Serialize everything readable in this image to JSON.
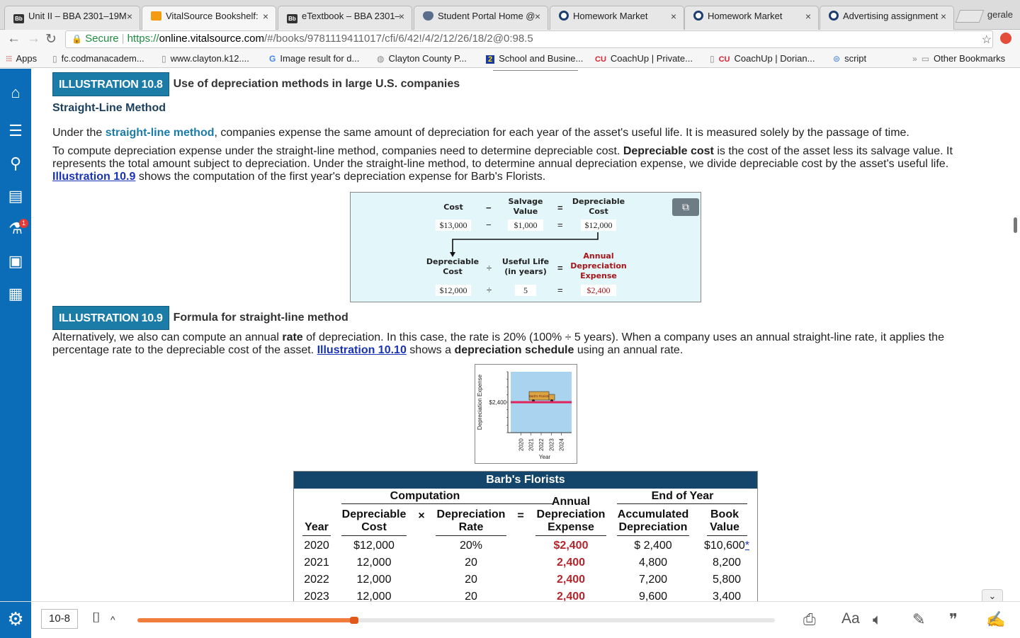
{
  "browser": {
    "tabs": [
      {
        "label": "Unit II – BBA 2301–19M",
        "icon": "bb"
      },
      {
        "label": "VitalSource Bookshelf: ",
        "icon": "vs"
      },
      {
        "label": "eTextbook – BBA 2301–",
        "icon": "bb"
      },
      {
        "label": "Student Portal Home @ ",
        "icon": "shield"
      },
      {
        "label": "Homework Market",
        "icon": "hex"
      },
      {
        "label": "Homework Market",
        "icon": "hex"
      },
      {
        "label": "Advertising assignment",
        "icon": "hex"
      }
    ],
    "profile": "gerale",
    "address": {
      "secure_label": "Secure",
      "protocol": "https://",
      "host": "online.vitalsource.com",
      "path": "/#/books/9781119411017/cfi/6/42!/4/2/12/26/18/2@0:98.5"
    },
    "bookmarks": [
      {
        "label": "Apps",
        "icon": "apps"
      },
      {
        "label": "fc.codmanacadem...",
        "icon": "page"
      },
      {
        "label": "www.clayton.k12....",
        "icon": "page"
      },
      {
        "label": "Image result for d...",
        "icon": "google"
      },
      {
        "label": "Clayton County P...",
        "icon": "globe"
      },
      {
        "label": "School and Busine...",
        "icon": "two"
      },
      {
        "label": "CoachUp | Private...",
        "icon": "cu"
      },
      {
        "label": "CoachUp | Dorian...",
        "icon": "cu"
      },
      {
        "label": "script",
        "icon": "script"
      },
      {
        "label": "Other Bookmarks",
        "icon": "folder"
      }
    ]
  },
  "content": {
    "ill108": {
      "tag": "ILLUSTRATION 10.8",
      "title": "Use of depreciation methods in large U.S. companies"
    },
    "section_heading": "Straight-Line Method",
    "para1": {
      "before": "Under the ",
      "term": "straight-line method",
      "after": ", companies expense the same amount of depreciation for each year of the asset's useful life. It is measured solely by the passage of time."
    },
    "para2": {
      "t1": "To compute depreciation expense under the straight-line method, companies need to determine depreciable cost. ",
      "bold1": "Depreciable cost",
      "t2": " is the cost of the asset less its salvage value. It represents the total amount subject to depreciation. Under the straight-line method, to determine annual depreciation expense, we divide depreciable cost by the asset's useful life. ",
      "link": "Illustration 10.9",
      "t3": " shows the computation of the first year's depreciation expense for Barb's Florists."
    },
    "formula": {
      "row1_labels": {
        "cost": "Cost",
        "minus": "−",
        "salvage": "Salvage\nValue",
        "equals": "=",
        "depreciable": "Depreciable\nCost"
      },
      "row1_values": {
        "cost": "$13,000",
        "minus": "−",
        "salvage": "$1,000",
        "equals": "=",
        "depreciable": "$12,000"
      },
      "row2_labels": {
        "depreciable": "Depreciable\nCost",
        "divide": "÷",
        "useful_life": "Useful Life\n(in years)",
        "equals": "=",
        "annual": "Annual\nDepreciation\nExpense"
      },
      "row2_values": {
        "depreciable": "$12,000",
        "divide": "÷",
        "useful_life": "5",
        "equals": "=",
        "annual": "$2,400"
      }
    },
    "ill109": {
      "tag": "ILLUSTRATION 10.9",
      "title": "Formula for straight-line method"
    },
    "para3": {
      "t1": "Alternatively, we also can compute an annual ",
      "bold1": "rate",
      "t2": " of depreciation. In this case, the rate is 20% (100% ÷ 5 years). When a company uses an annual straight-line rate, it applies the percentage rate to the depreciable cost of the asset. ",
      "link": "Illustration 10.10",
      "t3": " shows a ",
      "bold2": "depreciation schedule",
      "t4": " using an annual rate."
    },
    "chart_data": {
      "type": "line",
      "ylabel": "Depreciation Expense",
      "xlabel": "Year",
      "x": [
        "2020",
        "2021",
        "2022",
        "2023",
        "2024"
      ],
      "series": [
        {
          "values": [
            2400,
            2400,
            2400,
            2400,
            2400
          ]
        }
      ],
      "value_label": "$2,400",
      "truck_label": "Barb's Florists",
      "colors": {
        "plot_bg": "#a9d3ef",
        "line": "#e2245a"
      }
    },
    "table": {
      "title": "Barb's Florists",
      "group_computation": "Computation",
      "group_end": "End of Year",
      "headers": {
        "year": "Year",
        "dep_cost": "Depreciable\nCost",
        "times": "×",
        "dep_rate": "Depreciation\nRate",
        "equals": "=",
        "annual": "Annual\nDepreciation\nExpense",
        "accum": "Accumulated\nDepreciation",
        "book": "Book\nValue"
      },
      "rows": [
        {
          "year": "2020",
          "cost": "$12,000",
          "rate": "20%",
          "expense": "$2,400",
          "accum": "$ 2,400",
          "book": "$10,600",
          "mark": "*"
        },
        {
          "year": "2021",
          "cost": "12,000",
          "rate": "20",
          "expense": "2,400",
          "accum": "4,800",
          "book": "8,200",
          "mark": ""
        },
        {
          "year": "2022",
          "cost": "12,000",
          "rate": "20",
          "expense": "2,400",
          "accum": "7,200",
          "book": "5,800",
          "mark": ""
        },
        {
          "year": "2023",
          "cost": "12,000",
          "rate": "20",
          "expense": "2,400",
          "accum": "9,600",
          "book": "3,400",
          "mark": ""
        }
      ]
    }
  },
  "reader": {
    "page_label": "10-8",
    "progress": 0.34,
    "accent": "#0b6cb8",
    "progress_color": "#f07d3c",
    "badge_count": "1",
    "font_tool_label": "Aa"
  }
}
